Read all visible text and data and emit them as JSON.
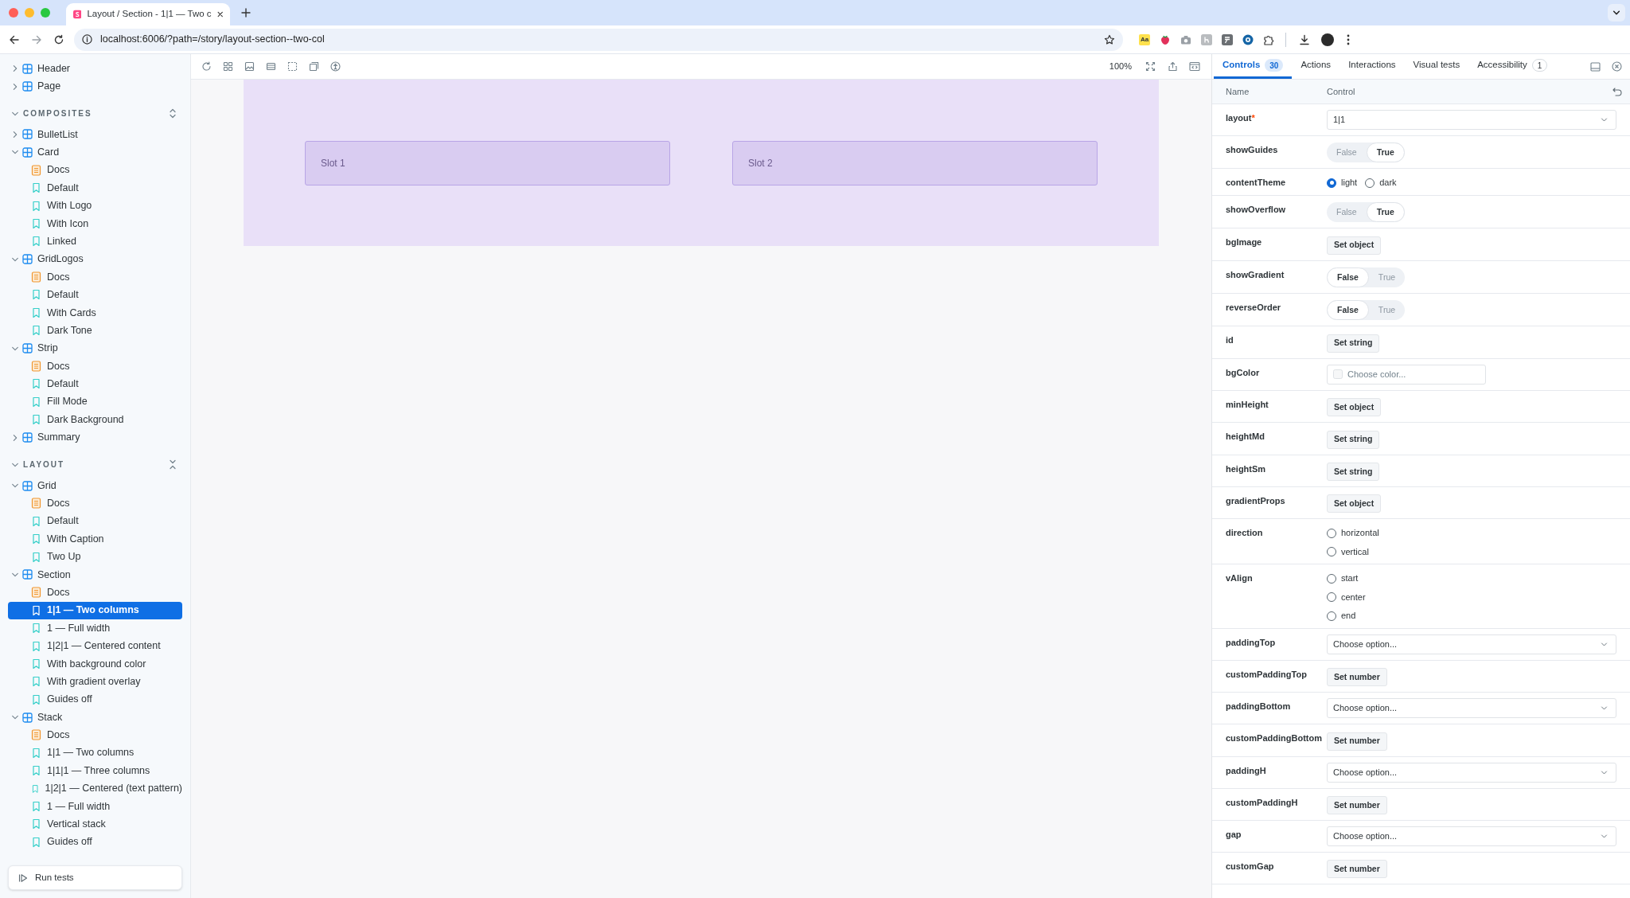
{
  "browser": {
    "tab_title": "Layout / Section - 1|1 — Two c",
    "url": "localhost:6006/?path=/story/layout-section--two-col",
    "extension_label": "Aa"
  },
  "sidebar": {
    "sections": [
      {
        "items": [
          {
            "label": "Header",
            "kind": "component",
            "expanded": false
          },
          {
            "label": "Page",
            "kind": "component",
            "expanded": false
          }
        ]
      },
      {
        "label": "COMPOSITES",
        "all_expanded": false,
        "items": [
          {
            "label": "BulletList",
            "kind": "component",
            "expanded": false
          },
          {
            "label": "Card",
            "kind": "component",
            "expanded": true,
            "children": [
              {
                "label": "Docs",
                "kind": "docs",
                "selected": false
              },
              {
                "label": "Default",
                "kind": "story",
                "selected": false
              },
              {
                "label": "With Logo",
                "kind": "story",
                "selected": false
              },
              {
                "label": "With Icon",
                "kind": "story",
                "selected": false
              },
              {
                "label": "Linked",
                "kind": "story",
                "selected": false
              }
            ]
          },
          {
            "label": "GridLogos",
            "kind": "component",
            "expanded": true,
            "children": [
              {
                "label": "Docs",
                "kind": "docs",
                "selected": false
              },
              {
                "label": "Default",
                "kind": "story",
                "selected": false
              },
              {
                "label": "With Cards",
                "kind": "story",
                "selected": false
              },
              {
                "label": "Dark Tone",
                "kind": "story",
                "selected": false
              }
            ]
          },
          {
            "label": "Strip",
            "kind": "component",
            "expanded": true,
            "children": [
              {
                "label": "Docs",
                "kind": "docs",
                "selected": false
              },
              {
                "label": "Default",
                "kind": "story",
                "selected": false
              },
              {
                "label": "Fill Mode",
                "kind": "story",
                "selected": false
              },
              {
                "label": "Dark Background",
                "kind": "story",
                "selected": false
              }
            ]
          },
          {
            "label": "Summary",
            "kind": "component",
            "expanded": false
          }
        ]
      },
      {
        "label": "LAYOUT",
        "all_expanded": true,
        "items": [
          {
            "label": "Grid",
            "kind": "component",
            "expanded": true,
            "children": [
              {
                "label": "Docs",
                "kind": "docs",
                "selected": false
              },
              {
                "label": "Default",
                "kind": "story",
                "selected": false
              },
              {
                "label": "With Caption",
                "kind": "story",
                "selected": false
              },
              {
                "label": "Two Up",
                "kind": "story",
                "selected": false
              }
            ]
          },
          {
            "label": "Section",
            "kind": "component",
            "expanded": true,
            "children": [
              {
                "label": "Docs",
                "kind": "docs",
                "selected": false
              },
              {
                "label": "1|1 — Two columns",
                "kind": "story",
                "selected": true
              },
              {
                "label": "1 — Full width",
                "kind": "story",
                "selected": false
              },
              {
                "label": "1|2|1 — Centered content",
                "kind": "story",
                "selected": false
              },
              {
                "label": "With background color",
                "kind": "story",
                "selected": false
              },
              {
                "label": "With gradient overlay",
                "kind": "story",
                "selected": false
              },
              {
                "label": "Guides off",
                "kind": "story",
                "selected": false
              }
            ]
          },
          {
            "label": "Stack",
            "kind": "component",
            "expanded": true,
            "children": [
              {
                "label": "Docs",
                "kind": "docs",
                "selected": false
              },
              {
                "label": "1|1 — Two columns",
                "kind": "story",
                "selected": false
              },
              {
                "label": "1|1|1 — Three columns",
                "kind": "story",
                "selected": false
              },
              {
                "label": "1|2|1 — Centered (text pattern)",
                "kind": "story",
                "selected": false
              },
              {
                "label": "1 — Full width",
                "kind": "story",
                "selected": false
              },
              {
                "label": "Vertical stack",
                "kind": "story",
                "selected": false
              },
              {
                "label": "Guides off",
                "kind": "story",
                "selected": false
              }
            ]
          }
        ]
      }
    ],
    "run_tests": "Run tests"
  },
  "toolbar": {
    "zoom": "100%"
  },
  "preview": {
    "slots": [
      "Slot 1",
      "Slot 2"
    ]
  },
  "panel_tabs": [
    {
      "label": "Controls",
      "badge": "30",
      "selected": true
    },
    {
      "label": "Actions",
      "selected": false
    },
    {
      "label": "Interactions",
      "selected": false
    },
    {
      "label": "Visual tests",
      "selected": false
    },
    {
      "label": "Accessibility",
      "badge": "1",
      "selected": false
    }
  ],
  "controls": {
    "name_heading": "Name",
    "control_heading": "Control",
    "rows": [
      {
        "name": "layout",
        "required_mark": "*",
        "kind": "select",
        "value": "1|1"
      },
      {
        "name": "showGuides",
        "kind": "toggle",
        "options": [
          {
            "label": "False",
            "selected": false
          },
          {
            "label": "True",
            "selected": true
          }
        ]
      },
      {
        "name": "contentTheme",
        "kind": "radio_inline",
        "options": [
          {
            "label": "light",
            "selected": true
          },
          {
            "label": "dark",
            "selected": false
          }
        ]
      },
      {
        "name": "showOverflow",
        "kind": "toggle",
        "options": [
          {
            "label": "False",
            "selected": false
          },
          {
            "label": "True",
            "selected": true
          }
        ]
      },
      {
        "name": "bgImage",
        "kind": "button",
        "label": "Set object"
      },
      {
        "name": "showGradient",
        "kind": "toggle",
        "options": [
          {
            "label": "False",
            "selected": true
          },
          {
            "label": "True",
            "selected": false
          }
        ]
      },
      {
        "name": "reverseOrder",
        "kind": "toggle",
        "options": [
          {
            "label": "False",
            "selected": true
          },
          {
            "label": "True",
            "selected": false
          }
        ]
      },
      {
        "name": "id",
        "kind": "button",
        "label": "Set string"
      },
      {
        "name": "bgColor",
        "kind": "color",
        "placeholder": "Choose color..."
      },
      {
        "name": "minHeight",
        "kind": "button",
        "label": "Set object"
      },
      {
        "name": "heightMd",
        "kind": "button",
        "label": "Set string"
      },
      {
        "name": "heightSm",
        "kind": "button",
        "label": "Set string"
      },
      {
        "name": "gradientProps",
        "kind": "button",
        "label": "Set object"
      },
      {
        "name": "direction",
        "kind": "radio",
        "options": [
          {
            "label": "horizontal",
            "selected": false
          },
          {
            "label": "vertical",
            "selected": false
          }
        ]
      },
      {
        "name": "vAlign",
        "kind": "radio",
        "options": [
          {
            "label": "start",
            "selected": false
          },
          {
            "label": "center",
            "selected": false
          },
          {
            "label": "end",
            "selected": false
          }
        ]
      },
      {
        "name": "paddingTop",
        "kind": "select",
        "placeholder": "Choose option..."
      },
      {
        "name": "customPaddingTop",
        "kind": "button",
        "label": "Set number"
      },
      {
        "name": "paddingBottom",
        "kind": "select",
        "placeholder": "Choose option..."
      },
      {
        "name": "customPaddingBottom",
        "kind": "button",
        "label": "Set number"
      },
      {
        "name": "paddingH",
        "kind": "select",
        "placeholder": "Choose option..."
      },
      {
        "name": "customPaddingH",
        "kind": "button",
        "label": "Set number"
      },
      {
        "name": "gap",
        "kind": "select",
        "placeholder": "Choose option..."
      },
      {
        "name": "customGap",
        "kind": "button",
        "label": "Set number"
      }
    ]
  }
}
